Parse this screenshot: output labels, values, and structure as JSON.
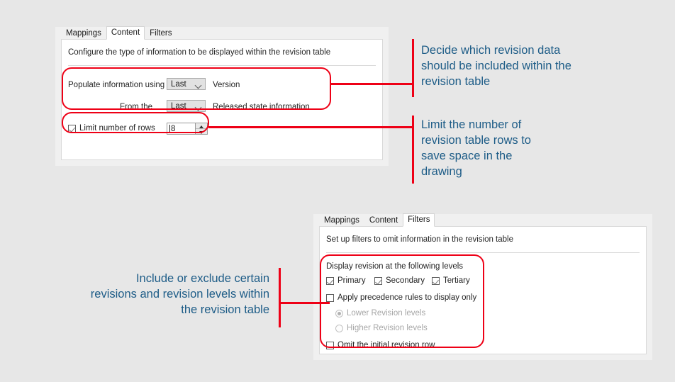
{
  "page": {
    "background_color": "#e7e7e7",
    "accent_red": "#ee0016",
    "caption_color": "#1d5c87"
  },
  "content_dialog": {
    "tabs": [
      {
        "label": "Mappings",
        "active": false
      },
      {
        "label": "Content",
        "active": true
      },
      {
        "label": "Filters",
        "active": false
      }
    ],
    "description": "Configure the type of information to be displayed within the revision table",
    "rows": [
      {
        "label": "Populate information using",
        "dropdown_value": "Last",
        "suffix": "Version"
      },
      {
        "label": "From the",
        "dropdown_value": "Last",
        "suffix": "Released state information"
      }
    ],
    "limit_rows": {
      "label": "Limit number of rows",
      "checked": true,
      "value": "8"
    }
  },
  "filters_dialog": {
    "tabs": [
      {
        "label": "Mappings",
        "active": false
      },
      {
        "label": "Content",
        "active": false
      },
      {
        "label": "Filters",
        "active": true
      }
    ],
    "description": "Set up filters to omit information in the revision table",
    "levels_label": "Display revision at the following levels",
    "levels": [
      {
        "label": "Primary",
        "checked": true
      },
      {
        "label": "Secondary",
        "checked": true
      },
      {
        "label": "Tertiary",
        "checked": true
      }
    ],
    "precedence": {
      "label": "Apply precedence rules to display only",
      "checked": false
    },
    "precedence_options": [
      {
        "label": "Lower Revision levels",
        "selected": true,
        "disabled": true
      },
      {
        "label": "Higher Revision levels",
        "selected": false,
        "disabled": true
      }
    ],
    "omit_initial": {
      "label": "Omit the initial revision row",
      "checked": false
    }
  },
  "annotations": [
    {
      "id": "revision-data",
      "text": "Decide which revision data\nshould be included within the\nrevision table"
    },
    {
      "id": "limit-rows",
      "text": "Limit the number of\nrevision table rows to\nsave space in the\ndrawing"
    },
    {
      "id": "include-exclude",
      "text": "Include or exclude certain\nrevisions and revision levels within\nthe revision table"
    }
  ]
}
